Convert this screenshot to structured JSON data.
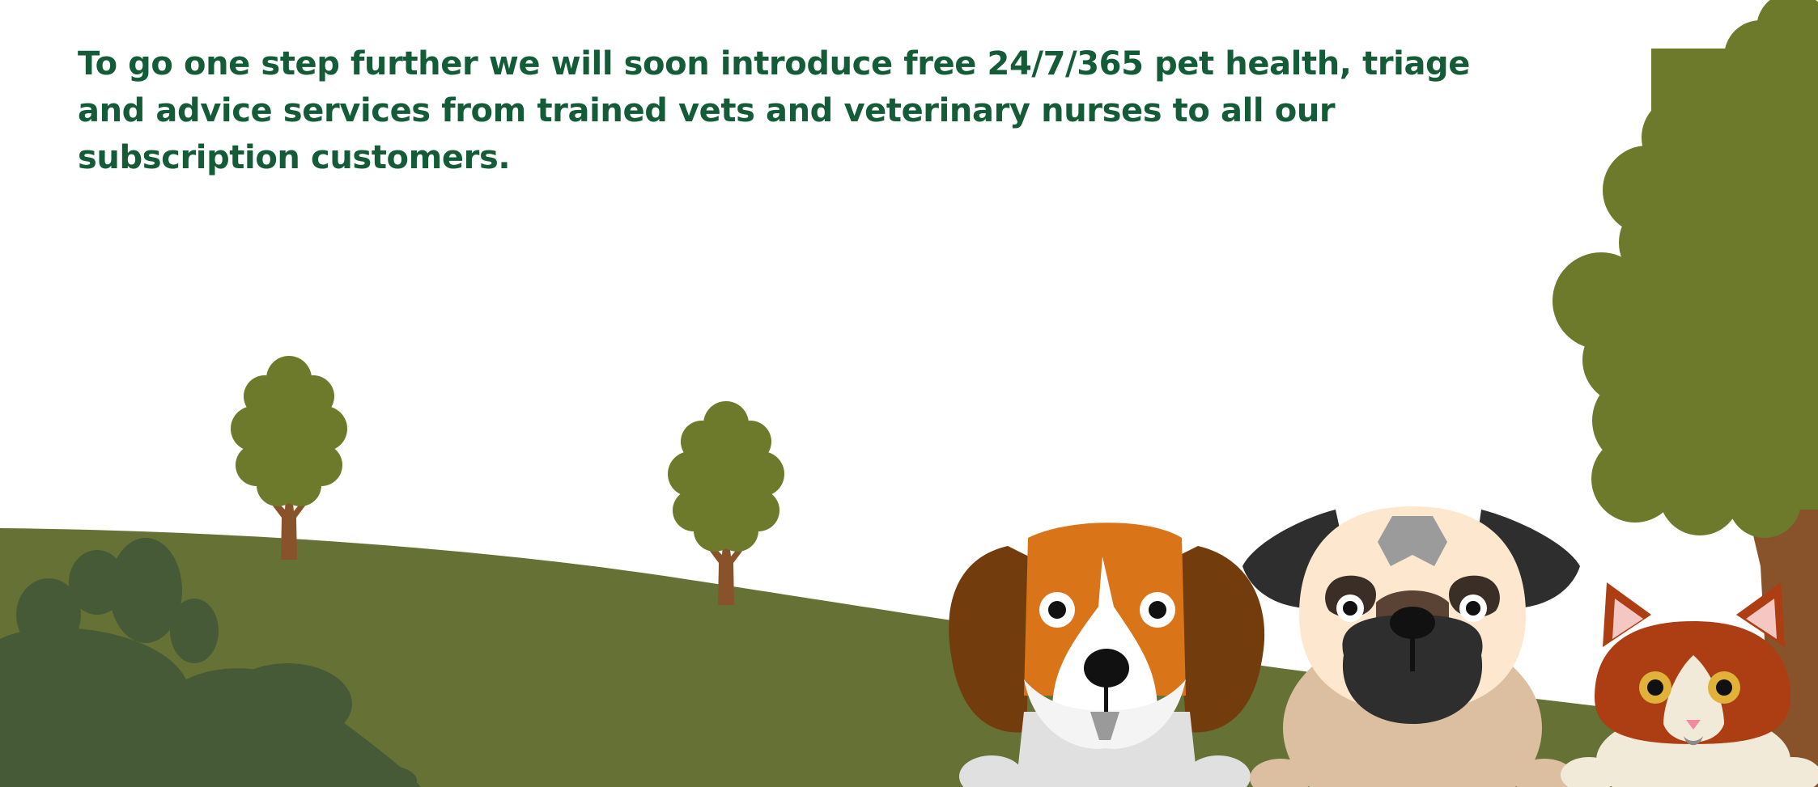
{
  "intro": {
    "text": "To go one step further we will soon introduce free 24/7/365 pet health, triage and advice services from trained vets and veterinary nurses to all our subscription customers."
  },
  "colors": {
    "text": "#145c38",
    "hill": "#667135",
    "bush": "#465a37",
    "tree_canopy": "#6d7a2b",
    "tree_trunk": "#88532a",
    "beagle_tan": "#d97419",
    "beagle_ear": "#733c0c",
    "pug_fawn": "#fde8cf",
    "pug_mask": "#2e2e2e",
    "cat_ginger": "#ad3d12",
    "cat_eye": "#e0b23a"
  },
  "icons": [
    "small-tree-icon",
    "large-tree-icon",
    "bush-icon",
    "beagle-icon",
    "pug-icon",
    "cat-icon"
  ]
}
